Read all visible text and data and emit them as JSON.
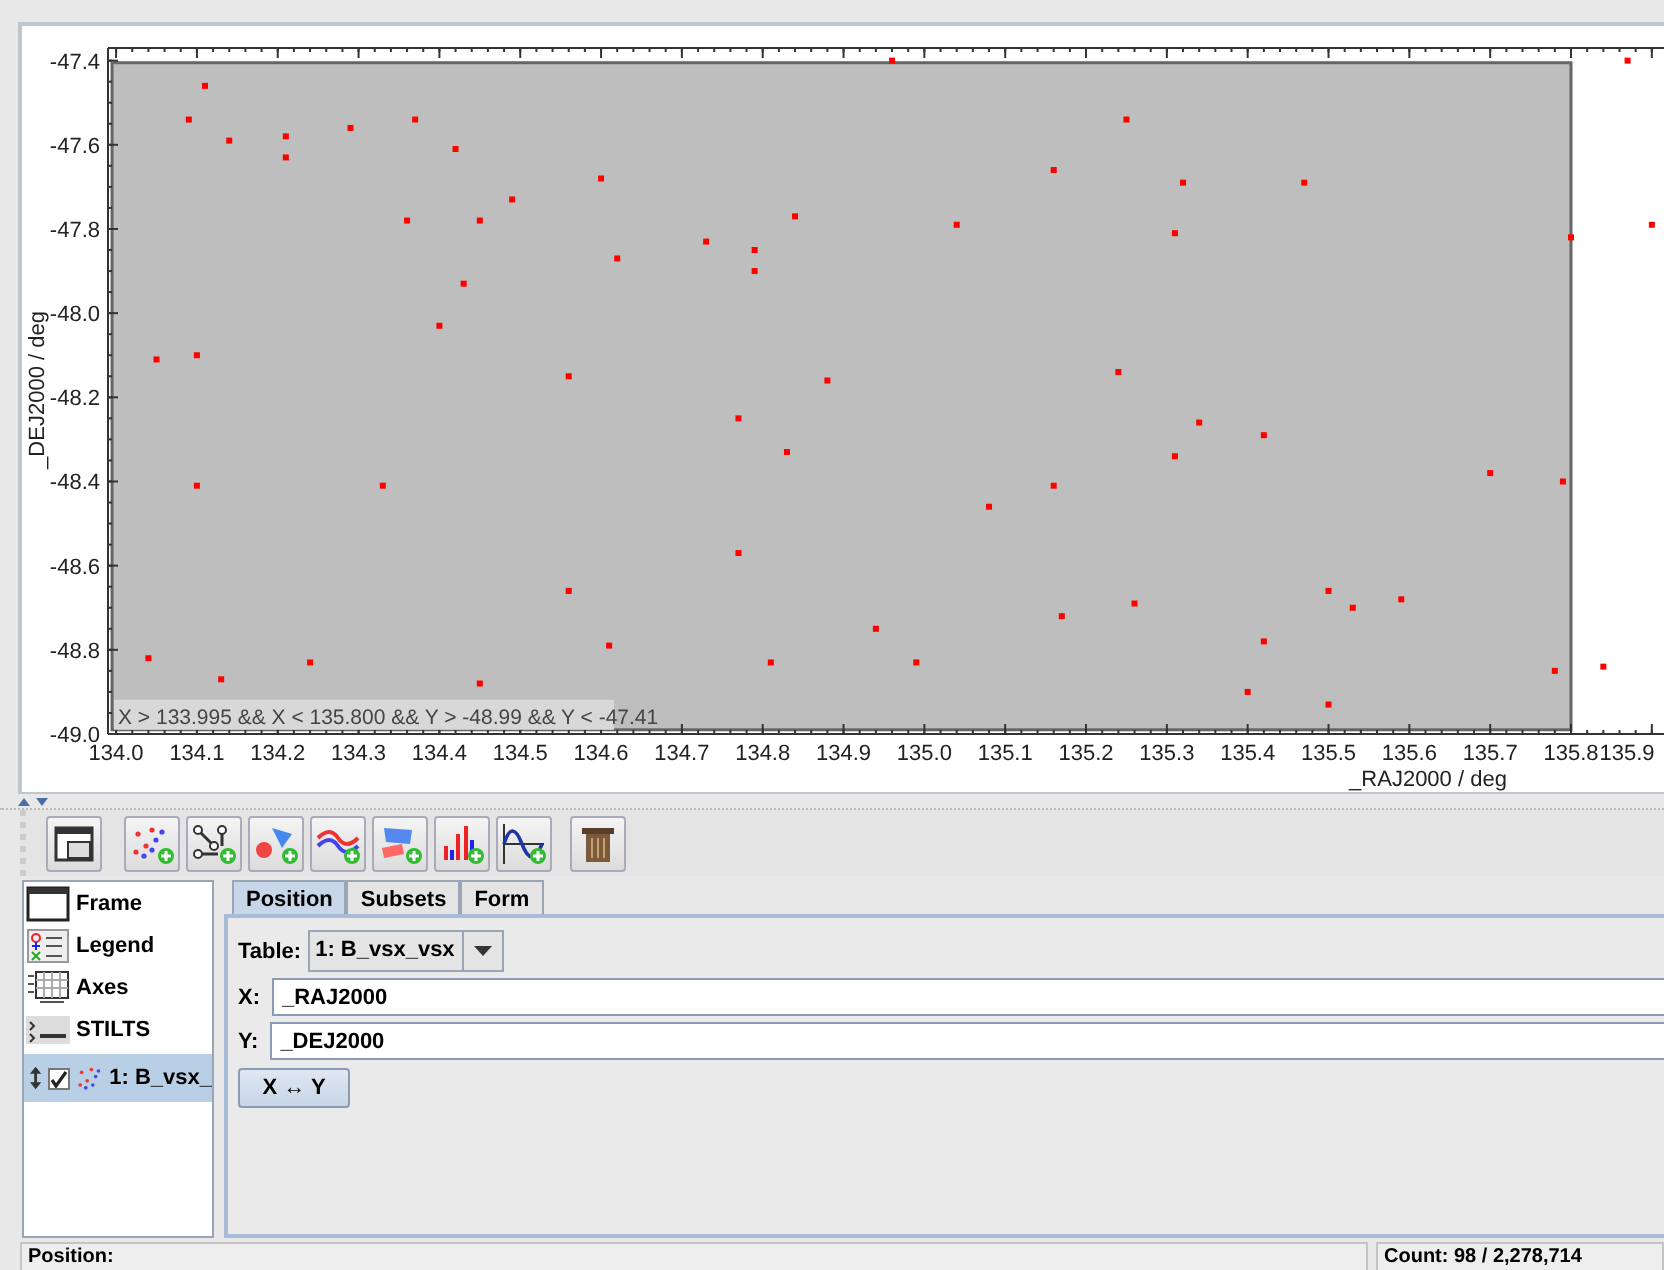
{
  "plot": {
    "chart_data": {
      "type": "scatter",
      "xlabel": "_RAJ2000 / deg",
      "ylabel": "_DEJ2000 / deg",
      "x": [
        134.11,
        134.09,
        134.14,
        134.21,
        134.21,
        134.29,
        134.37,
        134.42,
        134.36,
        134.45,
        134.43,
        134.4,
        134.49,
        134.6,
        134.62,
        134.05,
        134.1,
        134.1,
        134.33,
        134.04,
        134.13,
        134.24,
        134.45,
        134.56,
        134.61,
        134.56,
        134.73,
        134.79,
        134.79,
        134.84,
        134.77,
        134.83,
        134.88,
        134.77,
        134.81,
        134.94,
        134.96,
        134.99,
        135.04,
        135.08,
        135.16,
        135.16,
        135.17,
        135.25,
        135.24,
        135.26,
        135.32,
        135.31,
        135.34,
        135.31,
        135.42,
        135.4,
        135.42,
        135.47,
        135.5,
        135.5,
        135.53,
        135.59,
        135.7,
        135.78,
        135.79,
        135.8,
        135.84,
        135.87,
        135.9
      ],
      "series": [
        {
          "color": "#ff0000",
          "values": [
            -47.46,
            -47.54,
            -47.59,
            -47.58,
            -47.63,
            -47.56,
            -47.54,
            -47.61,
            -47.78,
            -47.78,
            -47.93,
            -48.03,
            -47.73,
            -47.68,
            -47.87,
            -48.11,
            -48.1,
            -48.41,
            -48.41,
            -48.82,
            -48.87,
            -48.83,
            -48.88,
            -48.66,
            -48.79,
            -48.15,
            -47.83,
            -47.85,
            -47.9,
            -47.77,
            -48.25,
            -48.33,
            -48.16,
            -48.57,
            -48.83,
            -48.75,
            -47.4,
            -48.83,
            -47.79,
            -48.46,
            -47.66,
            -48.41,
            -48.72,
            -47.54,
            -48.14,
            -48.69,
            -47.69,
            -47.81,
            -48.26,
            -48.34,
            -48.29,
            -48.9,
            -48.78,
            -47.69,
            -48.93,
            -48.66,
            -48.7,
            -48.68,
            -48.38,
            -48.85,
            -48.4,
            -47.82,
            -48.84,
            -47.4,
            -47.79
          ]
        }
      ],
      "xlim": [
        133.99,
        135.92
      ],
      "ylim": [
        -49.0,
        -47.37
      ],
      "xticks": [
        {
          "value": 134.0,
          "label": "134.0"
        },
        134.1,
        134.2,
        134.3,
        134.4,
        134.5,
        134.6,
        134.7,
        134.8,
        134.9,
        {
          "value": 135.0,
          "label": "135.0"
        },
        135.1,
        135.2,
        135.3,
        135.4,
        135.5,
        135.6,
        135.7,
        135.8,
        135.9
      ],
      "yticks": [
        {
          "value": -49.0,
          "label": "-49.0"
        },
        -48.8,
        -48.6,
        -48.4,
        -48.2,
        {
          "value": -48.0,
          "label": "-48.0"
        },
        -47.8,
        -47.6,
        -47.4
      ],
      "bands": [
        {
          "axis": "x",
          "from": 133.995,
          "to": 135.8
        }
      ],
      "annotations": [
        "X > 133.995 && X < 135.800 && Y > -48.99 && Y < -47.41"
      ]
    }
  },
  "toolbar": [
    {
      "kind": "frame"
    },
    {
      "kind": "scatter"
    },
    {
      "kind": "pairs"
    },
    {
      "kind": "shapes"
    },
    {
      "kind": "lines"
    },
    {
      "kind": "area"
    },
    {
      "kind": "histogram"
    },
    {
      "kind": "function"
    },
    {
      "kind": "delete"
    }
  ],
  "controls": [
    {
      "kind": "frame",
      "label": "Frame",
      "selected": false
    },
    {
      "kind": "legend",
      "label": "Legend",
      "selected": false
    },
    {
      "kind": "axes",
      "label": "Axes",
      "selected": false
    },
    {
      "kind": "stilts",
      "label": "STILTS",
      "selected": false
    }
  ],
  "layers": [
    {
      "label": "1: B_vsx_",
      "checked": true,
      "selected": true
    }
  ],
  "tabs": [
    {
      "label": "Position",
      "selected": true
    },
    {
      "label": "Subsets",
      "selected": false
    },
    {
      "label": "Form",
      "selected": false
    }
  ],
  "position": {
    "table_label": "Table:",
    "table_value": "1: B_vsx_vsx",
    "fields": [
      {
        "label": "X:",
        "value": "_RAJ2000"
      },
      {
        "label": "Y:",
        "value": "_DEJ2000"
      }
    ],
    "swap_button": "X ↔ Y"
  },
  "status_bar": {
    "position_label": "Position:",
    "count": "Count: 98 / 2,278,714"
  }
}
